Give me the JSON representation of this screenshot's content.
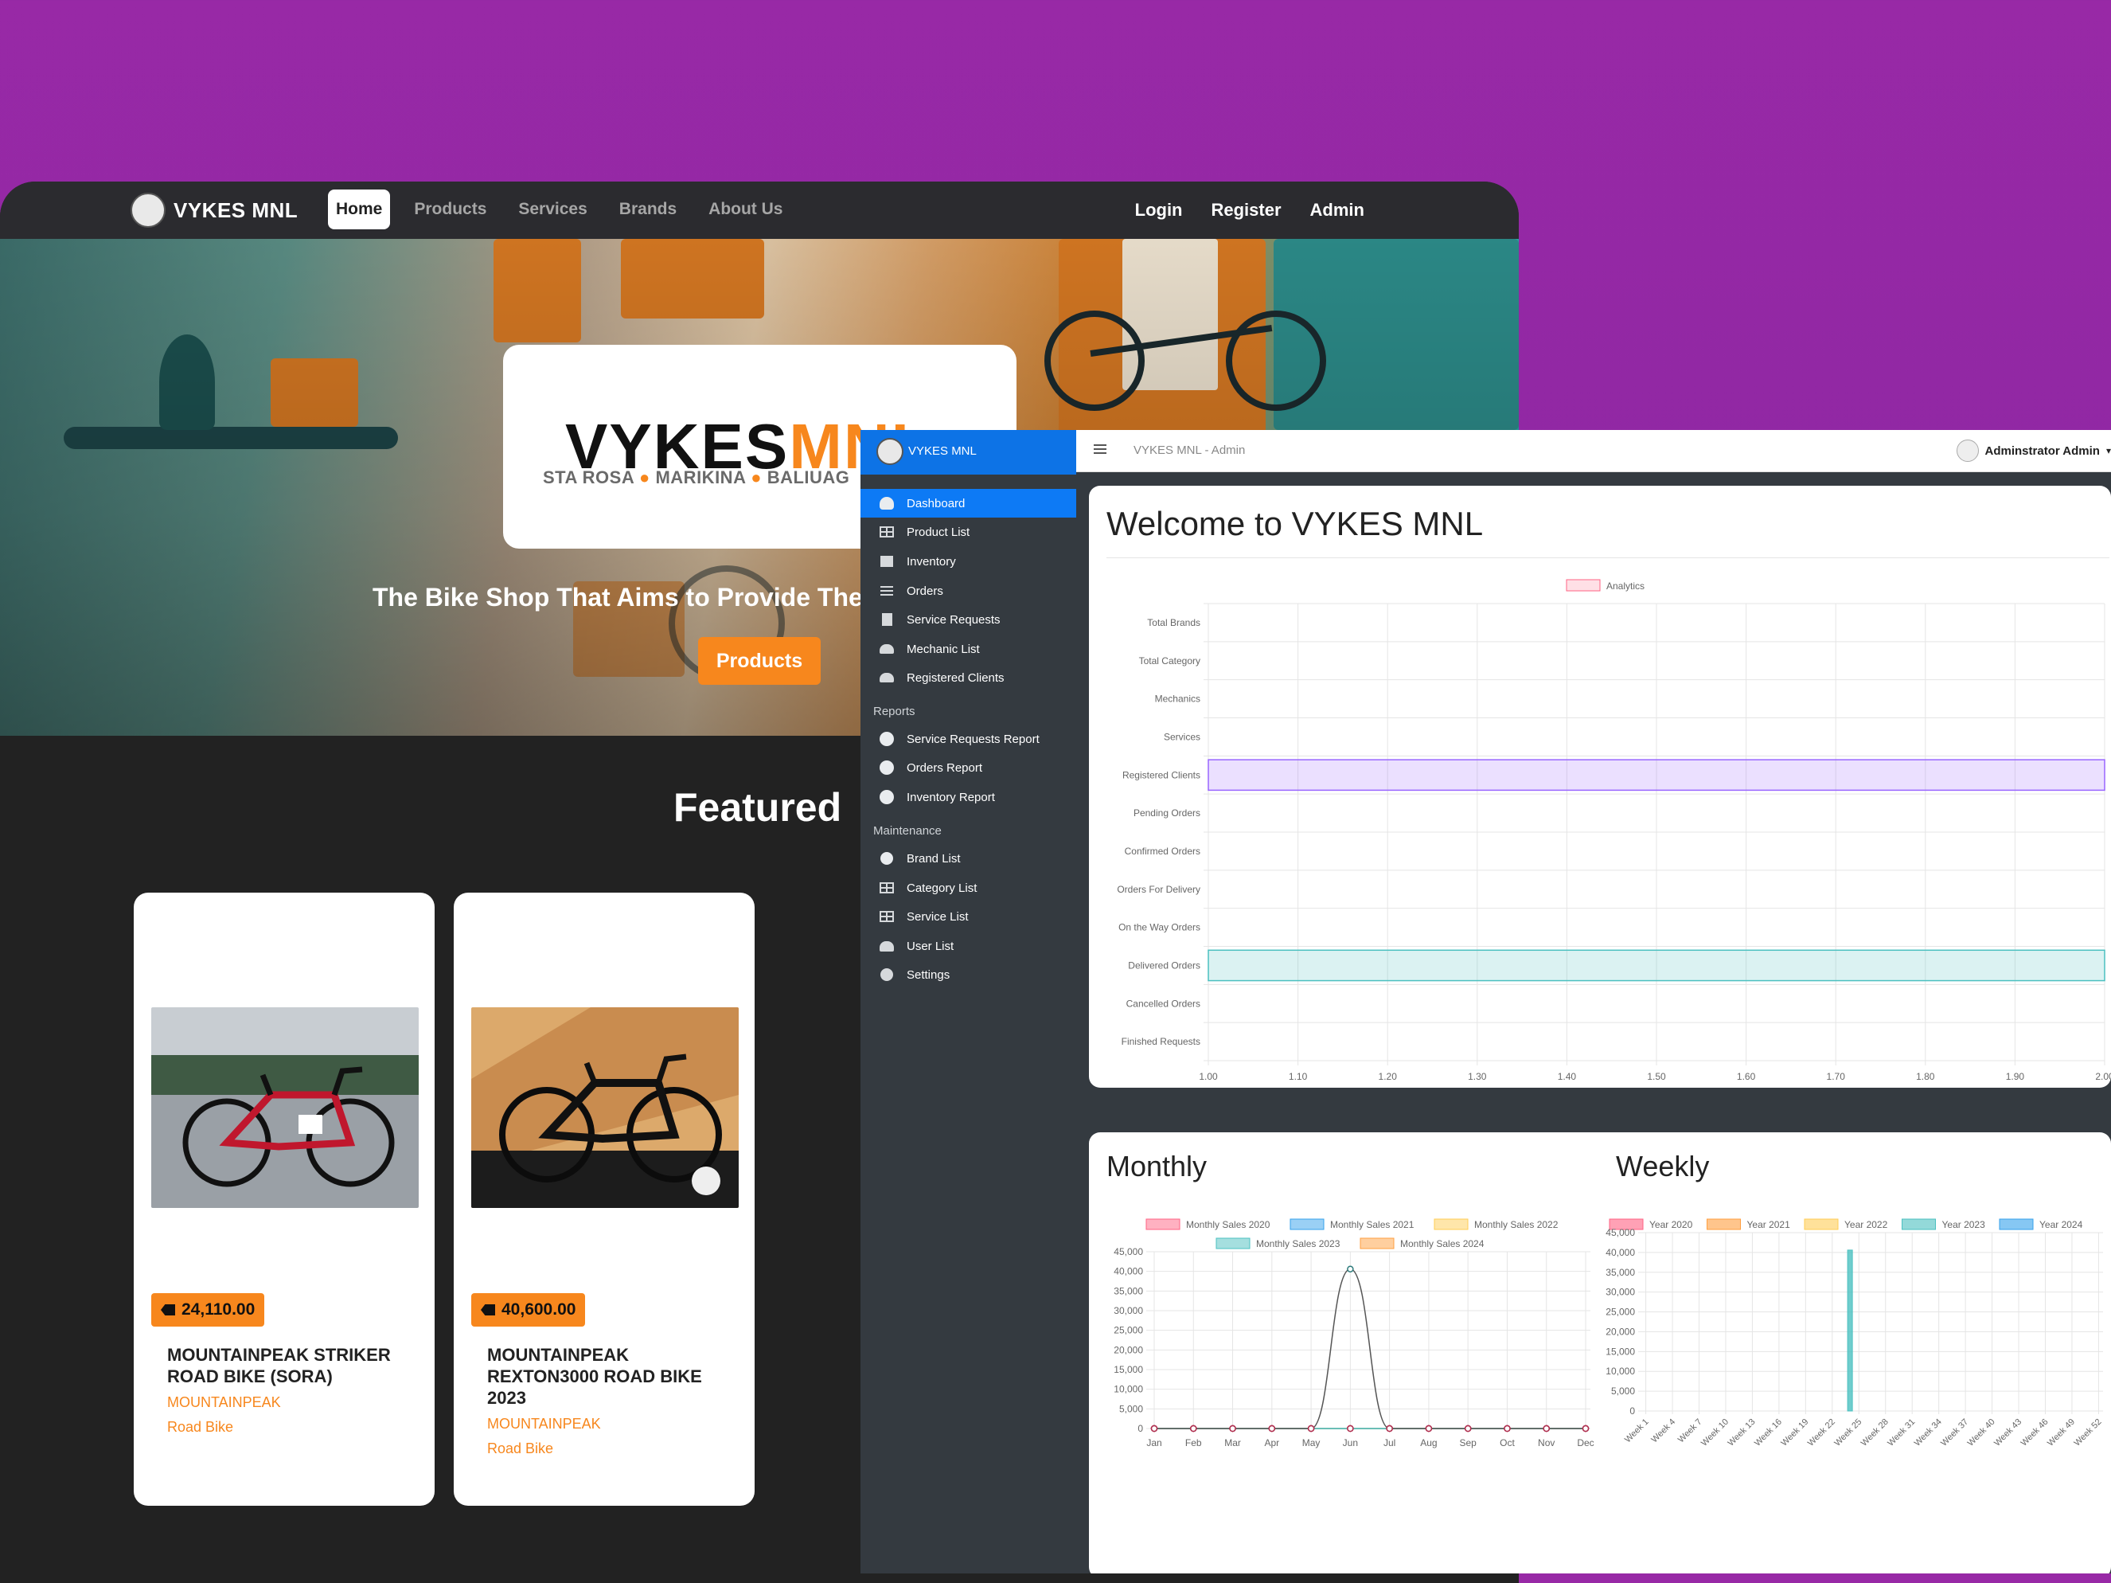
{
  "storefront": {
    "brand": "VYKES MNL",
    "brand_logo_text": "VYKES MNL",
    "nav": [
      "Home",
      "Products",
      "Services",
      "Brands",
      "About Us"
    ],
    "nav_right": [
      "Login",
      "Register",
      "Admin"
    ],
    "hero": {
      "logo_main": "VYKES",
      "logo_accent": "MNL",
      "locations": [
        "STA ROSA",
        "MARIKINA",
        "BALIUAG"
      ],
      "tagline": "The Bike Shop That Aims to Provide The",
      "button": "Products"
    },
    "featured_title": "Featured",
    "products": [
      {
        "price": "24,110.00",
        "name": "MOUNTAINPEAK STRIKER ROAD BIKE (SORA)",
        "brand": "MOUNTAINPEAK",
        "category": "Road Bike"
      },
      {
        "price": "40,600.00",
        "name": "MOUNTAINPEAK REXTON3000 ROAD BIKE 2023",
        "brand": "MOUNTAINPEAK",
        "category": "Road Bike"
      }
    ]
  },
  "admin": {
    "brand": "VYKES MNL",
    "topbar_title": "VYKES MNL - Admin",
    "user": "Adminstrator Admin",
    "menu": [
      {
        "label": "Dashboard",
        "icon": "dashboard-icon",
        "active": true
      },
      {
        "label": "Product List",
        "icon": "table-icon"
      },
      {
        "label": "Inventory",
        "icon": "inventory-icon"
      },
      {
        "label": "Orders",
        "icon": "list-icon"
      },
      {
        "label": "Service Requests",
        "icon": "file-icon"
      },
      {
        "label": "Mechanic List",
        "icon": "users-icon"
      },
      {
        "label": "Registered Clients",
        "icon": "users-group-icon"
      }
    ],
    "reports_heading": "Reports",
    "reports": [
      "Service Requests Report",
      "Orders Report",
      "Inventory Report"
    ],
    "maintenance_heading": "Maintenance",
    "maintenance": [
      {
        "label": "Brand List",
        "icon": "copyright-icon"
      },
      {
        "label": "Category List",
        "icon": "table-icon"
      },
      {
        "label": "Service List",
        "icon": "table-icon"
      },
      {
        "label": "User List",
        "icon": "users-cog-icon"
      },
      {
        "label": "Settings",
        "icon": "cogs-icon"
      }
    ],
    "welcome": "Welcome to VYKES MNL",
    "monthly_title": "Monthly",
    "weekly_title": "Weekly"
  },
  "chart_data": [
    {
      "type": "bar",
      "orientation": "horizontal",
      "legend": [
        "Analytics"
      ],
      "categories": [
        "Total Brands",
        "Total Category",
        "Mechanics",
        "Services",
        "Registered Clients",
        "Pending Orders",
        "Confirmed Orders",
        "Orders For Delivery",
        "On the Way Orders",
        "Delivered Orders",
        "Cancelled Orders",
        "Finished Requests"
      ],
      "values": [
        0,
        0,
        0,
        0,
        2,
        0,
        0,
        0,
        0,
        2,
        0,
        0
      ],
      "bar_colors": {
        "Registered Clients": "#9966ff",
        "Delivered Orders": "#4bc0c0"
      },
      "xlim": [
        1.0,
        2.0
      ],
      "xticks": [
        "1.00",
        "1.10",
        "1.20",
        "1.30",
        "1.40",
        "1.50",
        "1.60",
        "1.70",
        "1.80",
        "1.90",
        "2.00"
      ],
      "grid": true,
      "legend_position": "top"
    },
    {
      "type": "line",
      "title": "Monthly",
      "categories": [
        "Jan",
        "Feb",
        "Mar",
        "Apr",
        "May",
        "Jun",
        "Jul",
        "Aug",
        "Sep",
        "Oct",
        "Nov",
        "Dec"
      ],
      "series": [
        {
          "name": "Monthly Sales 2020",
          "color": "#ff6384",
          "values": [
            0,
            0,
            0,
            0,
            0,
            0,
            0,
            0,
            0,
            0,
            0,
            0
          ]
        },
        {
          "name": "Monthly Sales 2021",
          "color": "#36a2eb",
          "values": [
            0,
            0,
            0,
            0,
            0,
            0,
            0,
            0,
            0,
            0,
            0,
            0
          ]
        },
        {
          "name": "Monthly Sales 2022",
          "color": "#ffcd56",
          "values": [
            0,
            0,
            0,
            0,
            0,
            0,
            0,
            0,
            0,
            0,
            0,
            0
          ]
        },
        {
          "name": "Monthly Sales 2023",
          "color": "#4bc0c0",
          "values": [
            0,
            0,
            0,
            0,
            0,
            0,
            0,
            0,
            0,
            0,
            0,
            0
          ]
        },
        {
          "name": "Monthly Sales 2024",
          "color": "#ff9f40",
          "values": [
            0,
            0,
            0,
            0,
            0,
            40600,
            0,
            0,
            0,
            0,
            0,
            0
          ]
        }
      ],
      "ylim": [
        0,
        45000
      ],
      "yticks": [
        "0",
        "5,000",
        "10,000",
        "15,000",
        "20,000",
        "25,000",
        "30,000",
        "35,000",
        "40,000",
        "45,000"
      ],
      "grid": true,
      "legend_position": "top"
    },
    {
      "type": "bar",
      "title": "Weekly",
      "xtick_labels": [
        "Week 1",
        "Week 4",
        "Week 7",
        "Week 10",
        "Week 13",
        "Week 16",
        "Week 19",
        "Week 22",
        "Week 25",
        "Week 28",
        "Week 31",
        "Week 34",
        "Week 37",
        "Week 40",
        "Week 43",
        "Week 46",
        "Week 49",
        "Week 52"
      ],
      "weeks": 52,
      "series": [
        {
          "name": "Year 2020",
          "color": "#ff6384",
          "values": {}
        },
        {
          "name": "Year 2021",
          "color": "#ff9f40",
          "values": {}
        },
        {
          "name": "Year 2022",
          "color": "#ffcd56",
          "values": {}
        },
        {
          "name": "Year 2023",
          "color": "#4bc0c0",
          "values": {
            "Week 24": 40600
          }
        },
        {
          "name": "Year 2024",
          "color": "#36a2eb",
          "values": {}
        }
      ],
      "ylim": [
        0,
        45000
      ],
      "yticks": [
        "0",
        "5,000",
        "10,000",
        "15,000",
        "20,000",
        "25,000",
        "30,000",
        "35,000",
        "40,000",
        "45,000"
      ],
      "grid": true,
      "legend_position": "top"
    }
  ]
}
